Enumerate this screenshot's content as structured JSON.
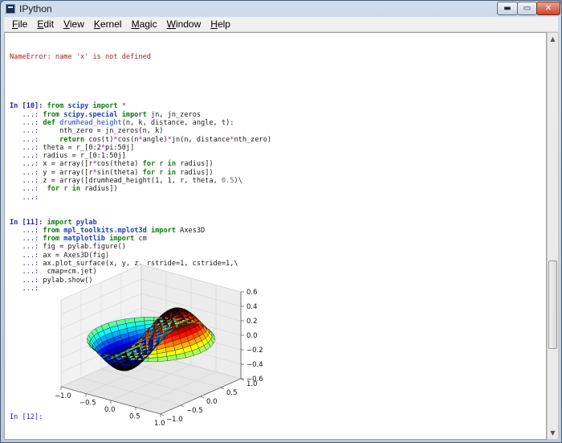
{
  "window": {
    "title": "IPython",
    "min_label": "▬",
    "max_label": "▭",
    "close_label": "✕"
  },
  "menu": [
    {
      "label": "File",
      "u": "F",
      "rest": "ile"
    },
    {
      "label": "Edit",
      "u": "E",
      "rest": "dit"
    },
    {
      "label": "View",
      "u": "V",
      "rest": "iew"
    },
    {
      "label": "Kernel",
      "u": "K",
      "rest": "ernel"
    },
    {
      "label": "Magic",
      "u": "M",
      "rest": "agic"
    },
    {
      "label": "Window",
      "u": "W",
      "rest": "indow"
    },
    {
      "label": "Help",
      "u": "H",
      "rest": "elp"
    }
  ],
  "error_line": "NameError: name 'x' is not defined",
  "cells": [
    {
      "prompt": "In [10]:",
      "lines": [
        [
          [
            "kw",
            "from "
          ],
          [
            "mod",
            "scipy"
          ],
          [
            "kw",
            " import "
          ],
          [
            "op",
            "*"
          ]
        ],
        [
          [
            "kw",
            "from "
          ],
          [
            "mod",
            "scipy.special"
          ],
          [
            "kw",
            " import "
          ],
          [
            "t",
            "jn, jn_zeros"
          ]
        ],
        [
          [
            "kw",
            "def "
          ],
          [
            "fn",
            "drumhead_height"
          ],
          [
            "t",
            "(n, k, distance, angle, t):"
          ]
        ],
        [
          [
            "t",
            "    nth_zero = jn_zeros(n, k)"
          ]
        ],
        [
          [
            "t",
            "    "
          ],
          [
            "kw",
            "return "
          ],
          [
            "t",
            "cos(t)"
          ],
          [
            "op",
            "*"
          ],
          [
            "t",
            "cos(n"
          ],
          [
            "op",
            "*"
          ],
          [
            "t",
            "angle)"
          ],
          [
            "op",
            "*"
          ],
          [
            "t",
            "jn(n, distance"
          ],
          [
            "op",
            "*"
          ],
          [
            "t",
            "nth_zero)"
          ]
        ],
        [
          [
            "t",
            "theta = r_[0:2"
          ],
          [
            "op",
            "*"
          ],
          [
            "t",
            "pi:50j]"
          ]
        ],
        [
          [
            "t",
            "radius = r_[0:1:50j]"
          ]
        ],
        [
          [
            "t",
            "x = array([r"
          ],
          [
            "op",
            "*"
          ],
          [
            "t",
            "cos(theta) "
          ],
          [
            "kw",
            "for "
          ],
          [
            "t",
            "r "
          ],
          [
            "kw",
            "in "
          ],
          [
            "t",
            "radius])"
          ]
        ],
        [
          [
            "t",
            "y = array([r"
          ],
          [
            "op",
            "*"
          ],
          [
            "t",
            "sin(theta) "
          ],
          [
            "kw",
            "for "
          ],
          [
            "t",
            "r "
          ],
          [
            "kw",
            "in "
          ],
          [
            "t",
            "radius])"
          ]
        ],
        [
          [
            "t",
            "z = array([drumhead_height(1, 1, r, theta, "
          ],
          [
            "num",
            "0.5"
          ],
          [
            "t",
            ")\\"
          ]
        ],
        [
          [
            "t",
            " "
          ],
          [
            "kw",
            "for "
          ],
          [
            "t",
            "r "
          ],
          [
            "kw",
            "in "
          ],
          [
            "t",
            "radius])"
          ]
        ],
        [
          [
            "t",
            ""
          ]
        ]
      ]
    },
    {
      "prompt": "In [11]:",
      "lines": [
        [
          [
            "kw",
            "import "
          ],
          [
            "mod",
            "pylab"
          ]
        ],
        [
          [
            "kw",
            "from "
          ],
          [
            "mod",
            "mpl_toolkits.mplot3d"
          ],
          [
            "kw",
            " import "
          ],
          [
            "t",
            "Axes3D"
          ]
        ],
        [
          [
            "kw",
            "from "
          ],
          [
            "mod",
            "matplotlib"
          ],
          [
            "kw",
            " import "
          ],
          [
            "t",
            "cm"
          ]
        ],
        [
          [
            "t",
            "fig = pylab.figure()"
          ]
        ],
        [
          [
            "t",
            "ax = Axes3D(fig)"
          ]
        ],
        [
          [
            "t",
            "ax.plot_surface(x, y, z, rstride=1, cstride=1,\\"
          ]
        ],
        [
          [
            "t",
            " cmap=cm.jet)"
          ]
        ],
        [
          [
            "t",
            "pylab.show()"
          ]
        ],
        [
          [
            "t",
            ""
          ]
        ]
      ]
    }
  ],
  "continuation": "   ...: ",
  "last_prompt": "In [12]:",
  "plot": {
    "z_ticks": [
      "0.6",
      "0.4",
      "0.2",
      "0.0",
      "−0.2",
      "−0.4",
      "−0.6"
    ],
    "x_ticks": [
      "−1.0",
      "−0.5",
      "0.0",
      "0.5",
      "1.0"
    ],
    "y_ticks": [
      "1.0",
      "0.5",
      "0.0",
      "−0.5",
      "−1.0"
    ],
    "z_range": [
      -0.6,
      0.6
    ],
    "x_range": [
      -1.0,
      1.0
    ],
    "y_range": [
      -1.0,
      1.0
    ],
    "colormap": "jet"
  }
}
